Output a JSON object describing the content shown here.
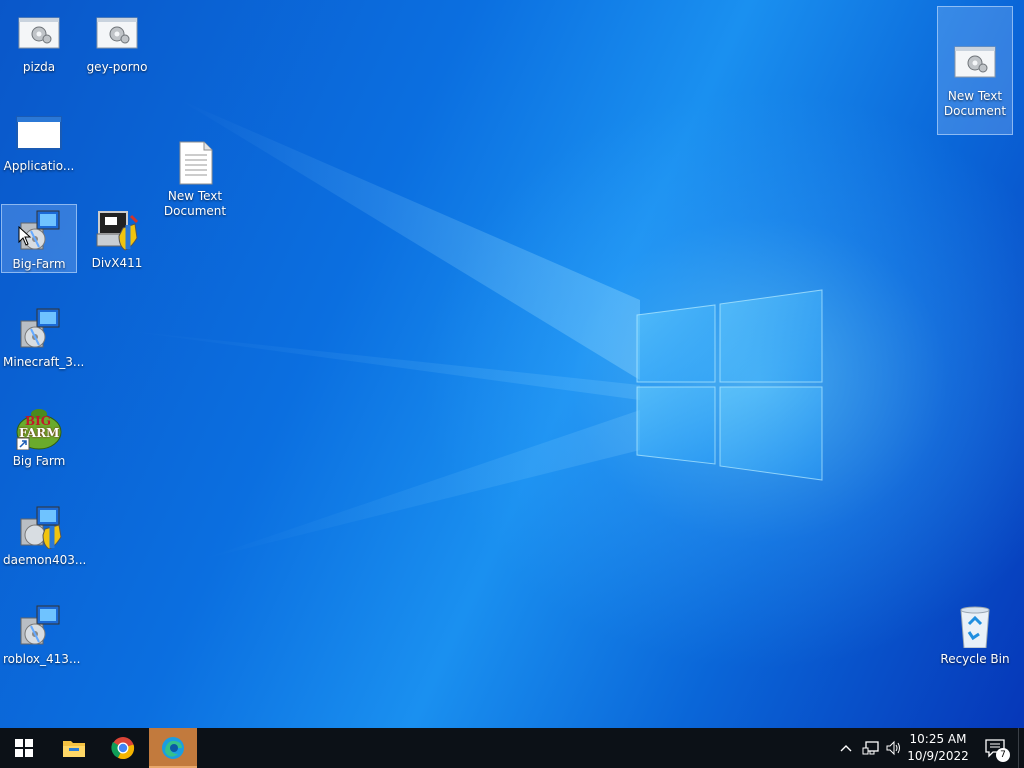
{
  "desktop": {
    "icons": [
      {
        "label": "pizda",
        "icon": "settings-file-icon"
      },
      {
        "label": "gey-porno",
        "icon": "settings-file-icon"
      },
      {
        "label": "Applicatio...",
        "icon": "application-window-icon"
      },
      {
        "label": "New Text\nDocument",
        "icon": "text-document-icon"
      },
      {
        "label": "Big-Farm",
        "icon": "installer-icon"
      },
      {
        "label": "DivX411",
        "icon": "installer-shield-icon"
      },
      {
        "label": "Minecraft_3...",
        "icon": "installer-icon"
      },
      {
        "label": "Big Farm",
        "icon": "big-farm-shortcut-icon"
      },
      {
        "label": "daemon403...",
        "icon": "installer-shield-icon"
      },
      {
        "label": "roblox_413...",
        "icon": "installer-icon"
      },
      {
        "label": "New Text\nDocument",
        "icon": "settings-file-icon"
      },
      {
        "label": "Recycle Bin",
        "icon": "recycle-bin-icon"
      }
    ],
    "big_farm_logo": {
      "line1": "BIG",
      "line2": "FARM"
    }
  },
  "taskbar": {
    "start": "windows-start-icon",
    "pinned": [
      "file-explorer-icon",
      "chrome-icon",
      "edge-icon"
    ],
    "tray": [
      "chevron-up-icon",
      "network-icon",
      "volume-icon"
    ],
    "clock": {
      "time": "10:25 AM",
      "date": "10/9/2022"
    },
    "notification_count": "7"
  },
  "colors": {
    "taskbar": "#0c1117",
    "active_app": "#c27a3d",
    "wallpaper": "#0a6fd8"
  }
}
